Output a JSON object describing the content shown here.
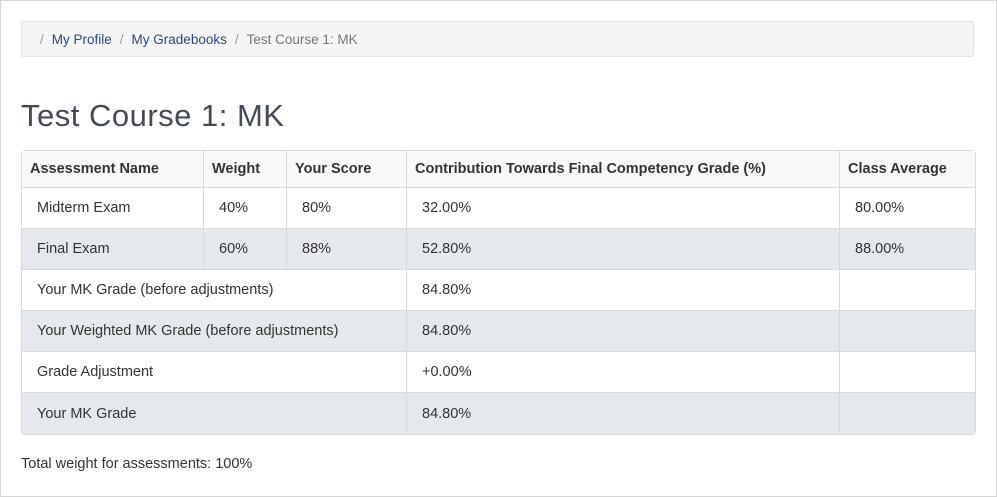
{
  "breadcrumb": {
    "items": [
      {
        "label": "My Profile"
      },
      {
        "label": "My Gradebooks"
      }
    ],
    "current": "Test Course 1: MK"
  },
  "page": {
    "title": "Test Course 1: MK"
  },
  "table": {
    "headers": [
      "Assessment Name",
      "Weight",
      "Your Score",
      "Contribution Towards Final Competency Grade (%)",
      "Class Average"
    ],
    "assessments": [
      {
        "name": "Midterm Exam",
        "weight": "40%",
        "score": "80%",
        "contribution": "32.00%",
        "class_average": "80.00%"
      },
      {
        "name": "Final Exam",
        "weight": "60%",
        "score": "88%",
        "contribution": "52.80%",
        "class_average": "88.00%"
      }
    ],
    "summary": [
      {
        "label": "Your MK Grade (before adjustments)",
        "value": "84.80%"
      },
      {
        "label": "Your Weighted MK Grade (before adjustments)",
        "value": "84.80%"
      },
      {
        "label": "Grade Adjustment",
        "value": "+0.00%"
      },
      {
        "label": "Your MK Grade",
        "value": "84.80%"
      }
    ]
  },
  "footer": {
    "total_weight": "Total weight for assessments: 100%"
  }
}
